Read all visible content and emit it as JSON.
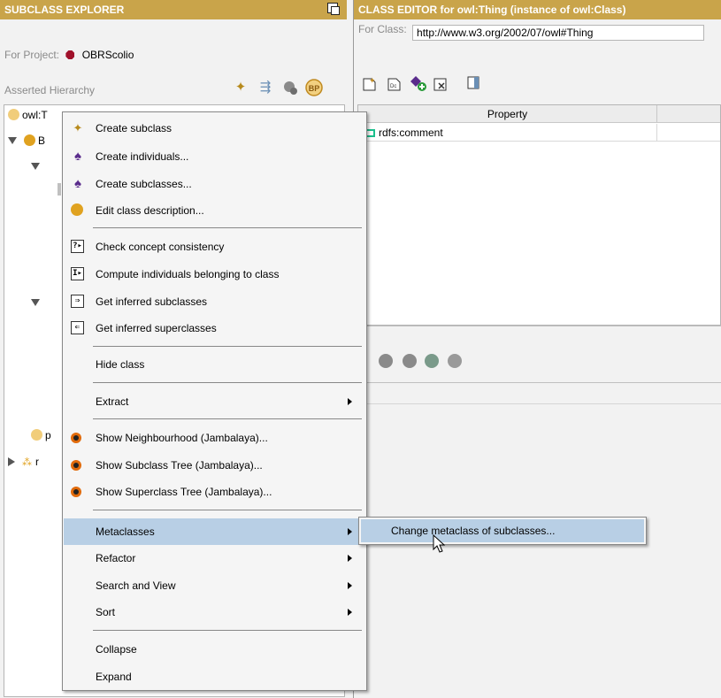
{
  "left_panel": {
    "title": "SUBCLASS EXPLORER",
    "project_label": "For Project:",
    "project_name": "OBRScolio",
    "hierarchy_label": "Asserted Hierarchy",
    "tool_icons": [
      "create-subclass-icon",
      "create-subclasses-icon",
      "delete-class-icon",
      "bp-icon"
    ],
    "tree": [
      {
        "label": "owl:T"
      },
      {
        "label": "B"
      },
      {
        "label": "p"
      },
      {
        "label": "r"
      }
    ]
  },
  "right_panel": {
    "title": "CLASS EDITOR for owl:Thing   (instance of owl:Class)",
    "for_class_label": "For Class:",
    "for_class_value": "http://www.w3.org/2002/07/owl#Thing",
    "table_header": "Property",
    "rows": [
      {
        "property": "rdfs:comment"
      }
    ]
  },
  "context_menu": {
    "items": [
      {
        "label": "Create subclass",
        "icon": "create-subclass-icon"
      },
      {
        "label": "Create individuals...",
        "icon": "wizard-icon"
      },
      {
        "label": "Create subclasses...",
        "icon": "wizard-icon"
      },
      {
        "label": "Edit class description...",
        "icon": "class-icon"
      },
      {
        "label": "Check concept consistency",
        "icon": "check-consistency-icon"
      },
      {
        "label": "Compute individuals belonging to class",
        "icon": "compute-individuals-icon"
      },
      {
        "label": "Get inferred subclasses",
        "icon": "inferred-subclasses-icon"
      },
      {
        "label": "Get inferred superclasses",
        "icon": "inferred-superclasses-icon"
      },
      {
        "label": "Hide class"
      },
      {
        "label": "Extract"
      },
      {
        "label": "Show Neighbourhood (Jambalaya)...",
        "icon": "jambalaya-icon"
      },
      {
        "label": "Show Subclass Tree (Jambalaya)...",
        "icon": "jambalaya-icon"
      },
      {
        "label": "Show Superclass Tree (Jambalaya)...",
        "icon": "jambalaya-icon"
      },
      {
        "label": "Metaclasses"
      },
      {
        "label": "Refactor"
      },
      {
        "label": "Search and View"
      },
      {
        "label": "Sort"
      },
      {
        "label": "Collapse"
      },
      {
        "label": "Expand"
      }
    ]
  },
  "submenu": {
    "items": [
      {
        "label": "Change metaclass of subclasses..."
      }
    ]
  },
  "colors": {
    "header_bg": "#c9a44a",
    "highlight": "#b8cfe5",
    "class_icon": "#e0a220",
    "project_icon": "#a0112b"
  }
}
